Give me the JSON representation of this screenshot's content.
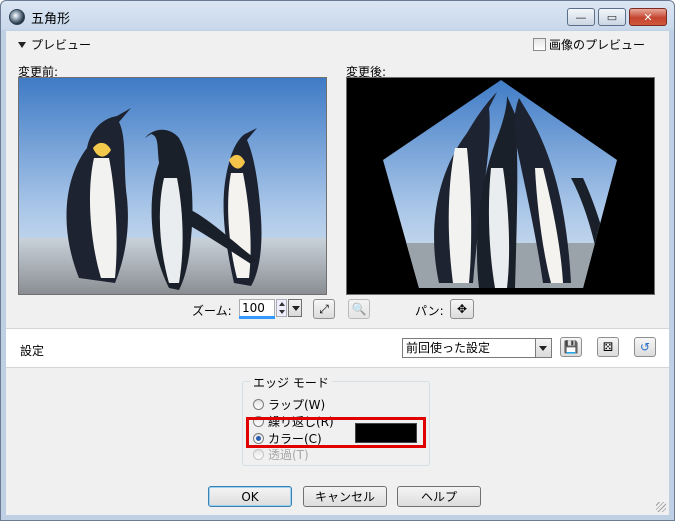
{
  "window": {
    "title": "五角形"
  },
  "preview": {
    "toggle_label": "プレビュー",
    "image_preview_label": "画像のプレビュー",
    "before_label": "変更前:",
    "after_label": "変更後:"
  },
  "zoom": {
    "label": "ズーム:",
    "value": "100"
  },
  "pan": {
    "label": "パン:"
  },
  "settings": {
    "label": "設定",
    "preset_value": "前回使った設定"
  },
  "edge_mode": {
    "title": "エッジ モード",
    "options": [
      {
        "label": "ラップ(W)",
        "selected": false,
        "enabled": true
      },
      {
        "label": "繰り返し(R)",
        "selected": false,
        "enabled": true
      },
      {
        "label": "カラー(C)",
        "selected": true,
        "enabled": true
      },
      {
        "label": "透過(T)",
        "selected": false,
        "enabled": false
      }
    ],
    "color_value": "#000000"
  },
  "buttons": {
    "ok": "OK",
    "cancel": "キャンセル",
    "help": "ヘルプ"
  },
  "colors": {
    "highlight": "#e00000",
    "title_bg": "#c9d8eb"
  },
  "icons": [
    "app-icon",
    "minimize-icon",
    "maximize-icon",
    "close-icon",
    "fit-window-icon",
    "zoom-tool-icon",
    "pan-move-icon",
    "save-preset-icon",
    "randomize-dice-icon",
    "reset-arrow-icon",
    "resize-grip-icon"
  ]
}
